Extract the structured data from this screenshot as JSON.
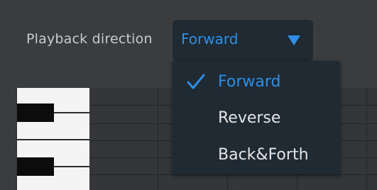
{
  "settings": {
    "playback_direction_label": "Playback direction",
    "playback_direction_value": "Forward"
  },
  "menu": {
    "items": [
      {
        "label": "Forward",
        "selected": true
      },
      {
        "label": "Reverse",
        "selected": false
      },
      {
        "label": "Back&Forth",
        "selected": false
      }
    ]
  },
  "colors": {
    "accent": "#2f8fe6",
    "dropdown_bg": "#1f2a33",
    "panel_bg": "#3a3c3e",
    "text_normal": "#e3e5e7"
  },
  "icons": {
    "dropdown_arrow": "triangle-down-icon",
    "selected_marker": "check-icon"
  }
}
